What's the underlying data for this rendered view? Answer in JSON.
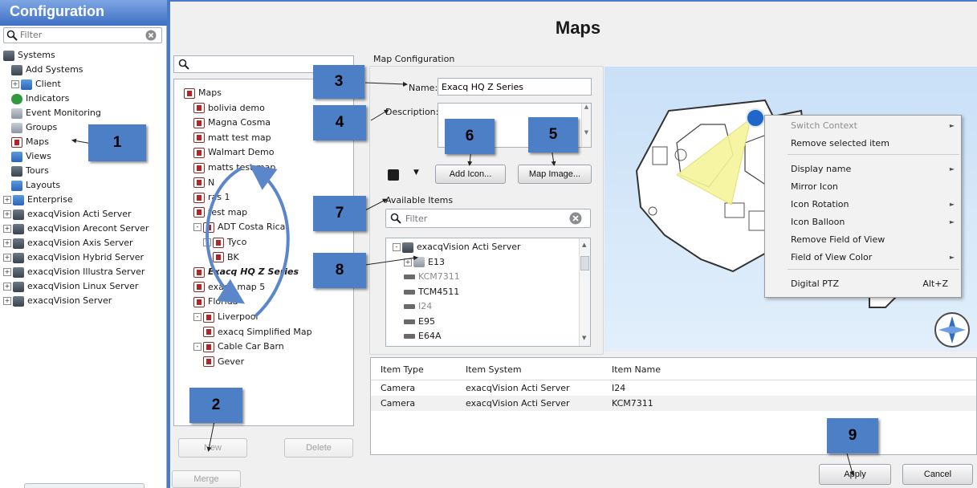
{
  "sidebar": {
    "title": "Configuration",
    "filter_placeholder": "Filter",
    "items": [
      {
        "label": "Systems",
        "indent": 0,
        "icon": "server-icon",
        "expander": ""
      },
      {
        "label": "Add Systems",
        "indent": 1,
        "icon": "add-systems-icon",
        "expander": ""
      },
      {
        "label": "Client",
        "indent": 1,
        "icon": "client-icon",
        "expander": "+"
      },
      {
        "label": "Indicators",
        "indent": 1,
        "icon": "indicators-icon",
        "expander": ""
      },
      {
        "label": "Event Monitoring",
        "indent": 1,
        "icon": "event-monitoring-icon",
        "expander": ""
      },
      {
        "label": "Groups",
        "indent": 1,
        "icon": "groups-icon",
        "expander": ""
      },
      {
        "label": "Maps",
        "indent": 1,
        "icon": "maps-icon",
        "expander": ""
      },
      {
        "label": "Views",
        "indent": 1,
        "icon": "views-icon",
        "expander": ""
      },
      {
        "label": "Tours",
        "indent": 1,
        "icon": "tours-icon",
        "expander": ""
      },
      {
        "label": "Layouts",
        "indent": 1,
        "icon": "layouts-icon",
        "expander": ""
      },
      {
        "label": "Enterprise",
        "indent": 0,
        "icon": "enterprise-icon",
        "expander": "+"
      },
      {
        "label": "exacqVision Acti Server",
        "indent": 0,
        "icon": "server-icon",
        "expander": "+"
      },
      {
        "label": "exacqVision Arecont Server",
        "indent": 0,
        "icon": "server-icon",
        "expander": "+"
      },
      {
        "label": "exacqVision Axis Server",
        "indent": 0,
        "icon": "server-icon",
        "expander": "+"
      },
      {
        "label": "exacqVision Hybrid Server",
        "indent": 0,
        "icon": "server-icon",
        "expander": "+"
      },
      {
        "label": "exacqVision Illustra Server",
        "indent": 0,
        "icon": "server-icon",
        "expander": "+"
      },
      {
        "label": "exacqVision Linux Server",
        "indent": 0,
        "icon": "server-icon",
        "expander": "+"
      },
      {
        "label": "exacqVision Server",
        "indent": 0,
        "icon": "server-icon",
        "expander": "+"
      }
    ]
  },
  "page": {
    "title": "Maps"
  },
  "map_tree": {
    "items": [
      {
        "label": "Maps",
        "indent": 0,
        "expander": "",
        "style": "normal"
      },
      {
        "label": "bolivia demo",
        "indent": 1,
        "expander": "",
        "style": "normal"
      },
      {
        "label": "Magna Cosma",
        "indent": 1,
        "expander": "",
        "style": "normal"
      },
      {
        "label": "matt test map",
        "indent": 1,
        "expander": "",
        "style": "normal"
      },
      {
        "label": "Walmart Demo",
        "indent": 1,
        "expander": "",
        "style": "normal"
      },
      {
        "label": "matts test map",
        "indent": 1,
        "expander": "",
        "style": "normal"
      },
      {
        "label": "N",
        "indent": 1,
        "expander": "",
        "style": "normal"
      },
      {
        "label": "ras 1",
        "indent": 1,
        "expander": "",
        "style": "normal"
      },
      {
        "label": "test map",
        "indent": 1,
        "expander": "",
        "style": "normal"
      },
      {
        "label": "ADT Costa Rica",
        "indent": 1,
        "expander": "-",
        "style": "normal"
      },
      {
        "label": "Tyco",
        "indent": 2,
        "expander": "-",
        "style": "normal"
      },
      {
        "label": "BK",
        "indent": 3,
        "expander": "",
        "style": "normal"
      },
      {
        "label": "Exacq HQ Z Series",
        "indent": 1,
        "expander": "",
        "style": "bold-italic"
      },
      {
        "label": "exacq map 5",
        "indent": 1,
        "expander": "",
        "style": "normal"
      },
      {
        "label": "Florida",
        "indent": 1,
        "expander": "",
        "style": "normal"
      },
      {
        "label": "Liverpool",
        "indent": 1,
        "expander": "-",
        "style": "normal"
      },
      {
        "label": "exacq Simplified Map",
        "indent": 2,
        "expander": "",
        "style": "normal"
      },
      {
        "label": "Cable Car Barn",
        "indent": 1,
        "expander": "-",
        "style": "normal"
      },
      {
        "label": "Gever",
        "indent": 2,
        "expander": "",
        "style": "normal"
      }
    ],
    "buttons": {
      "new": "New",
      "delete": "Delete",
      "merge": "Merge"
    }
  },
  "config": {
    "section_label": "Map Configuration",
    "name_label": "Name:",
    "name_value": "Exacq HQ Z Series",
    "description_label": "Description:",
    "add_icon_label": "Add Icon...",
    "map_image_label": "Map Image...",
    "available_items_label": "Available Items",
    "filter_placeholder": "Filter",
    "items": [
      {
        "label": "exacqVision Acti Server",
        "indent": 0,
        "expander": "-",
        "icon": "server",
        "muted": false
      },
      {
        "label": "E13",
        "indent": 1,
        "expander": "+",
        "icon": "cam-home",
        "muted": false
      },
      {
        "label": "KCM7311",
        "indent": 1,
        "expander": "",
        "icon": "cam-dome",
        "muted": true
      },
      {
        "label": "TCM4511",
        "indent": 1,
        "expander": "",
        "icon": "cam",
        "muted": false
      },
      {
        "label": "I24",
        "indent": 1,
        "expander": "",
        "icon": "cam",
        "muted": true
      },
      {
        "label": "E95",
        "indent": 1,
        "expander": "",
        "icon": "cam",
        "muted": false
      },
      {
        "label": "E64A",
        "indent": 1,
        "expander": "",
        "icon": "cam",
        "muted": false
      }
    ]
  },
  "context_menu": {
    "items": [
      {
        "label": "Switch Context",
        "submenu": true,
        "disabled": true,
        "shortcut": ""
      },
      {
        "label": "Remove selected item",
        "submenu": false,
        "disabled": false,
        "shortcut": ""
      },
      {
        "label": "Display name",
        "submenu": true,
        "disabled": false,
        "shortcut": ""
      },
      {
        "label": "Mirror Icon",
        "submenu": false,
        "disabled": false,
        "shortcut": ""
      },
      {
        "label": "Icon Rotation",
        "submenu": true,
        "disabled": false,
        "shortcut": ""
      },
      {
        "label": "Icon Balloon",
        "submenu": true,
        "disabled": false,
        "shortcut": ""
      },
      {
        "label": "Remove Field of View",
        "submenu": false,
        "disabled": false,
        "shortcut": ""
      },
      {
        "label": "Field of View Color",
        "submenu": true,
        "disabled": false,
        "shortcut": ""
      },
      {
        "label": "Digital PTZ",
        "submenu": false,
        "disabled": false,
        "shortcut": "Alt+Z"
      }
    ]
  },
  "grid": {
    "headers": [
      "Item Type",
      "Item System",
      "Item Name"
    ],
    "rows": [
      [
        "Camera",
        "exacqVision Acti Server",
        "I24"
      ],
      [
        "Camera",
        "exacqVision Acti Server",
        "KCM7311"
      ]
    ]
  },
  "actions": {
    "apply": "Apply",
    "cancel": "Cancel"
  },
  "callouts": [
    "1",
    "2",
    "3",
    "4",
    "5",
    "6",
    "7",
    "8",
    "9"
  ],
  "colors": {
    "badge": "#4d7fc6",
    "header_blue": "#4a79c6",
    "fov_yellow": "#f4f49a",
    "arrow_blue": "#5b86c9"
  }
}
